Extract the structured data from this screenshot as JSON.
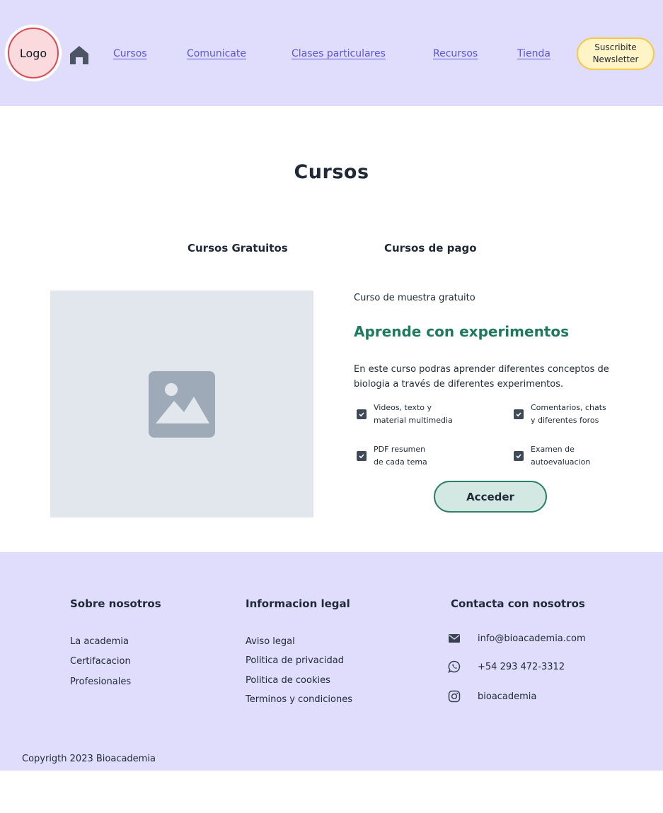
{
  "header": {
    "logo_label": "Logo",
    "nav": {
      "cursos": "Cursos",
      "comunicate": "Comunicate",
      "clases": "Clases particulares",
      "recursos": "Recursos",
      "tienda": "Tienda"
    },
    "newsletter": {
      "line1": "Suscribite",
      "line2": "Newsletter"
    }
  },
  "main": {
    "title": "Cursos",
    "tabs": {
      "free": "Cursos Gratuitos",
      "paid": "Cursos de pago"
    },
    "course": {
      "label": "Curso de muestra gratuito",
      "title": "Aprende con experimentos",
      "description": "En este curso podras aprender diferentes conceptos de biologia a través de diferentes experimentos.",
      "features": [
        {
          "line1": "Videos, texto y",
          "line2": "material multimedia"
        },
        {
          "line1": "Comentarios, chats",
          "line2": "y diferentes foros"
        },
        {
          "line1": "PDF resumen",
          "line2": "de cada tema"
        },
        {
          "line1": "Examen de",
          "line2": "autoevaluacion"
        }
      ],
      "button": "Acceder"
    }
  },
  "footer": {
    "about": {
      "heading": "Sobre nosotros",
      "links": [
        "La academia",
        "Certifacacion",
        "Profesionales"
      ]
    },
    "legal": {
      "heading": "Informacion legal",
      "links": [
        "Aviso legal",
        "Politica de privacidad",
        "Politica de cookies",
        "Terminos y condiciones"
      ]
    },
    "contact": {
      "heading": "Contacta con nosotros",
      "email": "info@bioacademia.com",
      "phone": "+54 293 472-3312",
      "instagram": "bioacademia"
    },
    "copyright": "Copyrigth 2023 Bioacademia"
  },
  "colors": {
    "header_bg": "#dfdcfc",
    "nav_link": "#5b55d6",
    "accent_green": "#1e7a5e",
    "newsletter_bg": "#fff4c5",
    "newsletter_border": "#f5c94a",
    "logo_border": "#dc4a57"
  }
}
